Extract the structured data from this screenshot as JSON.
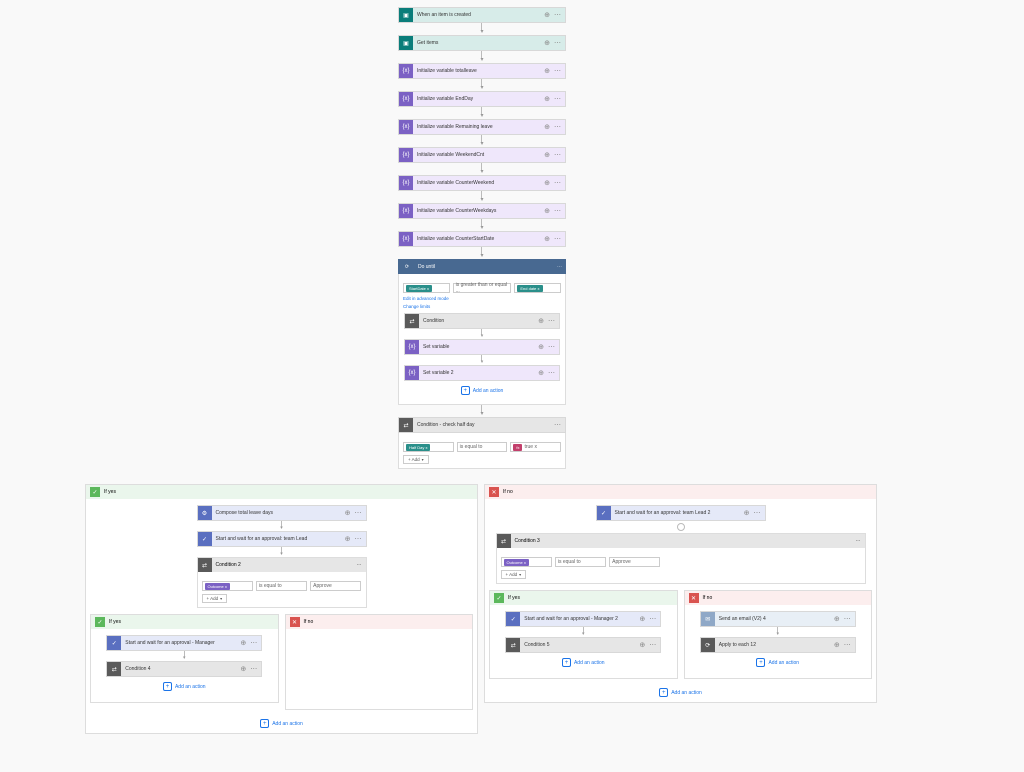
{
  "trigger": {
    "title": "When an item is created"
  },
  "getitems": {
    "title": "Get items"
  },
  "vars": [
    {
      "title": "Initialize variable totalleave"
    },
    {
      "title": "Initialize variable EndDay"
    },
    {
      "title": "Initialize variable Remaining leave"
    },
    {
      "title": "Initialize variable WeekendCnt"
    },
    {
      "title": "Initialize variable CounterWeekend"
    },
    {
      "title": "Initialize variable CounterWeekdays"
    },
    {
      "title": "Initialize variable CounterStartDate"
    }
  ],
  "do_until": {
    "title": "Do until",
    "cond": {
      "left": "StartDate x",
      "op": "is greater than or equal ...",
      "right": "End date x"
    },
    "edit_link": "Edit in advanced mode",
    "change_link": "Change limits",
    "steps": [
      {
        "title": "Condition",
        "type": "cond"
      },
      {
        "title": "Set variable",
        "type": "var"
      },
      {
        "title": "Set variable 2",
        "type": "var"
      }
    ],
    "add_action": "Add an action"
  },
  "cond_halfday": {
    "title": "Condition - check half day",
    "row": {
      "left": "Half Day x",
      "op": "is equal to",
      "right_icon": "fx",
      "right": "true x"
    },
    "add": "+ Add"
  },
  "yes_branch": {
    "label": "If yes",
    "compose": {
      "title": "Compose total leave days"
    },
    "approval": {
      "title": "Start and wait for an approval: team Lead"
    },
    "cond2": {
      "title": "Condition 2",
      "row": {
        "left": "Outcome x",
        "op": "is equal to",
        "right": "Approve"
      },
      "add": "+ Add"
    },
    "inner_yes": {
      "label": "If yes",
      "approval_mgr": {
        "title": "Start and wait for an approval - Manager"
      },
      "cond4": {
        "title": "Condition 4"
      },
      "add_action": "Add an action"
    },
    "inner_no": {
      "label": "If no"
    },
    "add_action": "Add an action"
  },
  "no_branch": {
    "label": "If no",
    "approval": {
      "title": "Start and wait for an approval: team Lead 2"
    },
    "cond3": {
      "title": "Condition 3",
      "row": {
        "left": "Outcome x",
        "op": "is equal to",
        "right": "Approve"
      },
      "add": "+ Add"
    },
    "inner_yes": {
      "label": "If yes",
      "approval_mgr": {
        "title": "Start and wait for an approval - Manager 2"
      },
      "cond5": {
        "title": "Condition 5"
      },
      "add_action": "Add an action"
    },
    "inner_no": {
      "label": "If no",
      "email": {
        "title": "Send an email (V2) 4"
      },
      "apply": {
        "title": "Apply to each 12"
      },
      "add_action": "Add an action"
    },
    "add_action": "Add an action"
  }
}
